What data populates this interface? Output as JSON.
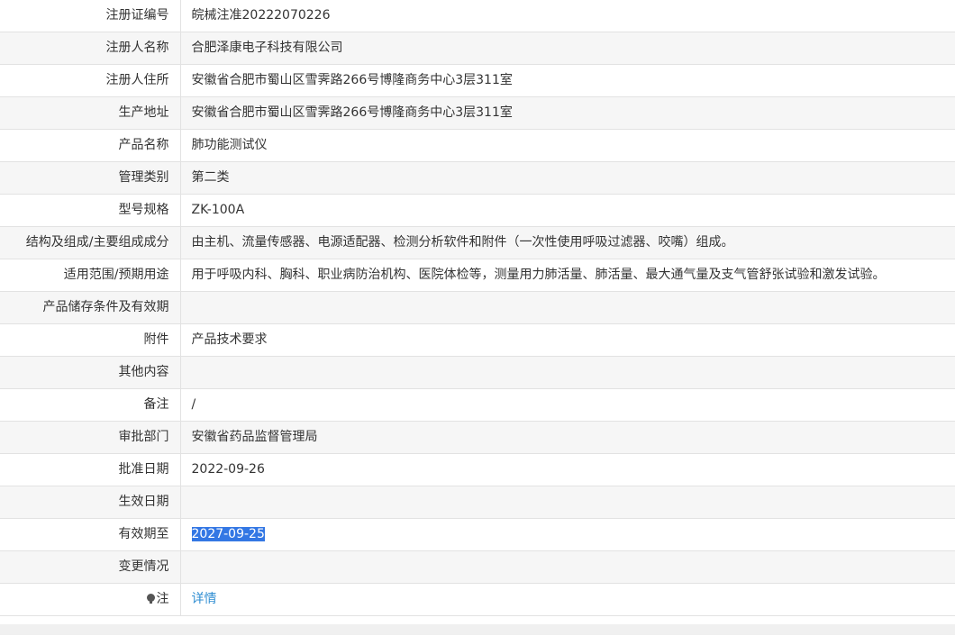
{
  "rows": [
    {
      "label": "注册证编号",
      "value": "皖械注准20222070226"
    },
    {
      "label": "注册人名称",
      "value": "合肥泽康电子科技有限公司"
    },
    {
      "label": "注册人住所",
      "value": "安徽省合肥市蜀山区雪霁路266号博隆商务中心3层311室"
    },
    {
      "label": "生产地址",
      "value": "安徽省合肥市蜀山区雪霁路266号博隆商务中心3层311室"
    },
    {
      "label": "产品名称",
      "value": "肺功能测试仪"
    },
    {
      "label": "管理类别",
      "value": "第二类"
    },
    {
      "label": "型号规格",
      "value": "ZK-100A"
    },
    {
      "label": "结构及组成/主要组成成分",
      "value": "由主机、流量传感器、电源适配器、检测分析软件和附件（一次性使用呼吸过滤器、咬嘴）组成。"
    },
    {
      "label": "适用范围/预期用途",
      "value": "用于呼吸内科、胸科、职业病防治机构、医院体检等，测量用力肺活量、肺活量、最大通气量及支气管舒张试验和激发试验。"
    },
    {
      "label": "产品储存条件及有效期",
      "value": ""
    },
    {
      "label": "附件",
      "value": "产品技术要求"
    },
    {
      "label": "其他内容",
      "value": ""
    },
    {
      "label": "备注",
      "value": "/"
    },
    {
      "label": "审批部门",
      "value": "安徽省药品监督管理局"
    },
    {
      "label": "批准日期",
      "value": "2022-09-26"
    },
    {
      "label": "生效日期",
      "value": ""
    },
    {
      "label": "有效期至",
      "value": "2027-09-25"
    },
    {
      "label": "变更情况",
      "value": ""
    },
    {
      "label": "注",
      "value": "详情"
    }
  ],
  "icons": {
    "note": "lightbulb-icon"
  },
  "colors": {
    "selection": "#3377e4",
    "link": "#2f8ed2"
  }
}
